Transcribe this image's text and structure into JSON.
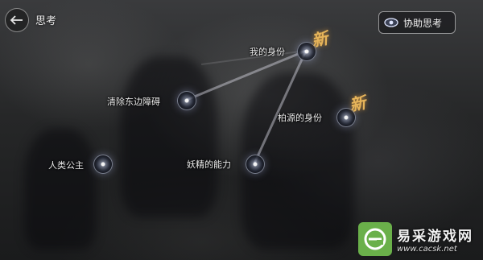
{
  "header": {
    "back_icon": "arrow-left-icon",
    "title": "思考",
    "assist_icon": "eye-icon",
    "assist_label": "协助思考"
  },
  "nodes": {
    "my_identity": {
      "label": "我的身份",
      "new_badge": "新"
    },
    "clear_barrier": {
      "label": "清除东边障碍"
    },
    "bailuyuan_identity": {
      "label": "柏源的身份",
      "new_badge": "新"
    },
    "human_princess": {
      "label": "人类公主"
    },
    "fairy_power": {
      "label": "妖精的能力"
    }
  },
  "watermark": {
    "brand": "易采游戏网",
    "url": "www.cacsk.net",
    "logo_color": "#6ab04a"
  },
  "colors": {
    "badge": "#e6b45a",
    "node_glow": "#c8d0f0",
    "text": "#ececec"
  }
}
